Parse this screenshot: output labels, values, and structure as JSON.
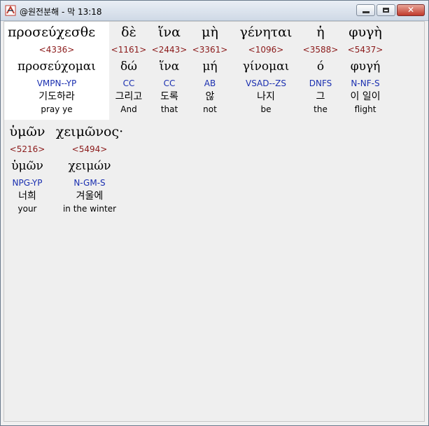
{
  "window": {
    "title": "@원전분해 - 막 13:18"
  },
  "rows": [
    {
      "words": [
        {
          "greek": "προσεύχεσθε",
          "strong": "<4336>",
          "lemma": "προσεύχομαι",
          "parse": "VMPN--YP",
          "korean": "기도하라",
          "english": "pray ye"
        },
        {
          "greek": "δὲ",
          "strong": "<1161>",
          "lemma": "δώ",
          "parse": "CC",
          "korean": "그리고",
          "english": "And"
        },
        {
          "greek": "ἵνα",
          "strong": "<2443>",
          "lemma": "ἵνα",
          "parse": "CC",
          "korean": "도록",
          "english": "that"
        },
        {
          "greek": "μὴ",
          "strong": "<3361>",
          "lemma": "μή",
          "parse": "AB",
          "korean": "않",
          "english": "not"
        },
        {
          "greek": "γένηται",
          "strong": "<1096>",
          "lemma": "γίνομαι",
          "parse": "VSAD--ZS",
          "korean": "나지",
          "english": "be"
        },
        {
          "greek": "ἡ",
          "strong": "<3588>",
          "lemma": "ό",
          "parse": "DNFS",
          "korean": "그",
          "english": "the"
        },
        {
          "greek": "φυγὴ",
          "strong": "<5437>",
          "lemma": "φυγή",
          "parse": "N-NF-S",
          "korean": "이 일이",
          "english": "flight"
        }
      ]
    },
    {
      "words": [
        {
          "greek": "ὑμῶν",
          "strong": "<5216>",
          "lemma": "ὑμῶν",
          "parse": "NPG-YP",
          "korean": "너희",
          "english": "your"
        },
        {
          "greek": "χειμῶνος·",
          "strong": "<5494>",
          "lemma": "χειμών",
          "parse": "N-GM-S",
          "korean": "겨울에",
          "english": "in the winter"
        }
      ]
    }
  ]
}
